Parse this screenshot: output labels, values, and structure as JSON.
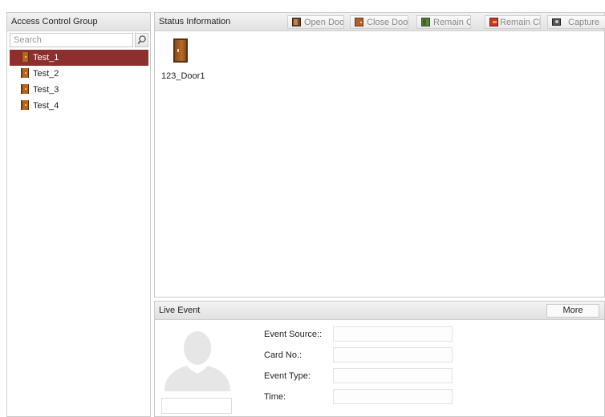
{
  "left_panel": {
    "title": "Access Control Group",
    "search_placeholder": "Search",
    "groups": [
      "Test_1",
      "Test_2",
      "Test_3",
      "Test_4"
    ],
    "selected_group": "Test_1"
  },
  "status_panel": {
    "title": "Status Information",
    "buttons": {
      "open_door": "Open Door",
      "close_door": "Close Door",
      "remain_open": "Remain O...",
      "remain_closed": "Remain Cl...",
      "capture": "Capture"
    },
    "door": {
      "label": "123_Door1"
    }
  },
  "live_event": {
    "title": "Live Event",
    "more": "More",
    "fields": {
      "event_source": "Event Source::",
      "card_no": "Card No.:",
      "event_type": "Event Type:",
      "time": "Time:"
    }
  },
  "colors": {
    "selected_row": "#8d2f2f",
    "header_bg": "#e6e6e6",
    "border": "#c9c9c9"
  }
}
